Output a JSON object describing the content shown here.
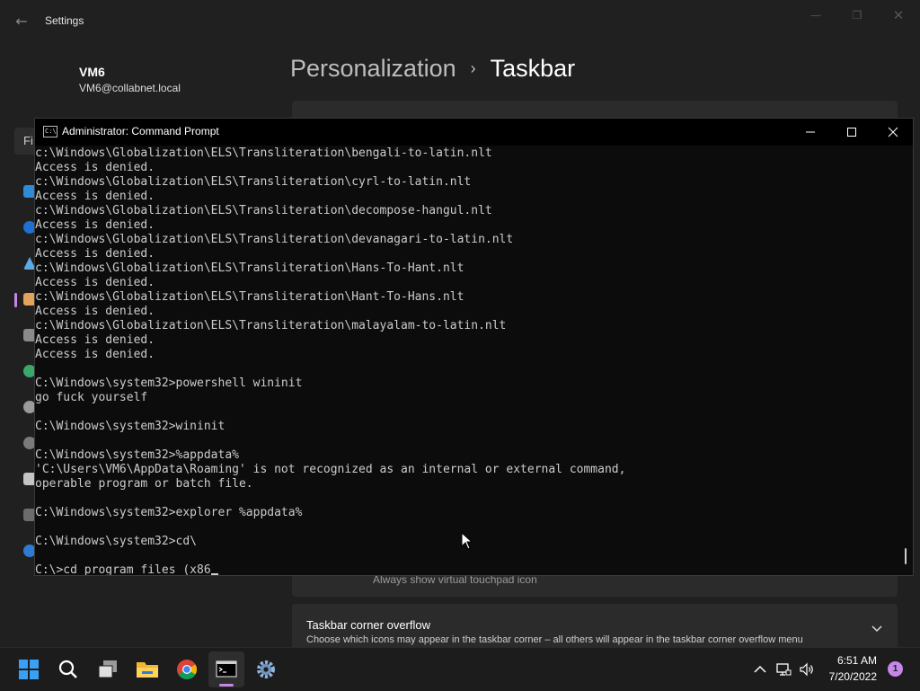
{
  "settings": {
    "app_title": "Settings",
    "account": {
      "name": "VM6",
      "email": "VM6@collabnet.local"
    },
    "search_fragment": "Fi",
    "breadcrumb": {
      "parent": "Personalization",
      "separator": "›",
      "current": "Taskbar"
    },
    "cards": {
      "touchpad_hint": "Always show virtual touchpad icon",
      "corner_overflow_title": "Taskbar corner overflow",
      "corner_overflow_desc": "Choose which icons may appear in the taskbar corner – all others will appear in the taskbar corner overflow menu"
    }
  },
  "cmd": {
    "title": "Administrator: Command Prompt",
    "icon_text": "C:\\",
    "lines": [
      "c:\\Windows\\Globalization\\ELS\\Transliteration\\bengali-to-latin.nlt",
      "Access is denied.",
      "c:\\Windows\\Globalization\\ELS\\Transliteration\\cyrl-to-latin.nlt",
      "Access is denied.",
      "c:\\Windows\\Globalization\\ELS\\Transliteration\\decompose-hangul.nlt",
      "Access is denied.",
      "c:\\Windows\\Globalization\\ELS\\Transliteration\\devanagari-to-latin.nlt",
      "Access is denied.",
      "c:\\Windows\\Globalization\\ELS\\Transliteration\\Hans-To-Hant.nlt",
      "Access is denied.",
      "c:\\Windows\\Globalization\\ELS\\Transliteration\\Hant-To-Hans.nlt",
      "Access is denied.",
      "c:\\Windows\\Globalization\\ELS\\Transliteration\\malayalam-to-latin.nlt",
      "Access is denied.",
      "Access is denied.",
      "",
      "C:\\Windows\\system32>powershell wininit",
      "go fuck yourself",
      "",
      "C:\\Windows\\system32>wininit",
      "",
      "C:\\Windows\\system32>%appdata%",
      "'C:\\Users\\VM6\\AppData\\Roaming' is not recognized as an internal or external command,",
      "operable program or batch file.",
      "",
      "C:\\Windows\\system32>explorer %appdata%",
      "",
      "C:\\Windows\\system32>cd\\",
      ""
    ],
    "current_input": "C:\\>cd program files (x86"
  },
  "taskbar": {
    "apps": [
      "start",
      "search",
      "task-view",
      "file-explorer",
      "chrome",
      "command-prompt",
      "settings"
    ],
    "active_app": "command-prompt",
    "tray": {
      "time": "6:51 AM",
      "date": "7/20/2022",
      "notification_count": "1"
    }
  },
  "colors": {
    "accent": "#c587e8",
    "console_bg": "#0c0c0c",
    "console_text": "#cccccc",
    "settings_bg": "#202020"
  }
}
